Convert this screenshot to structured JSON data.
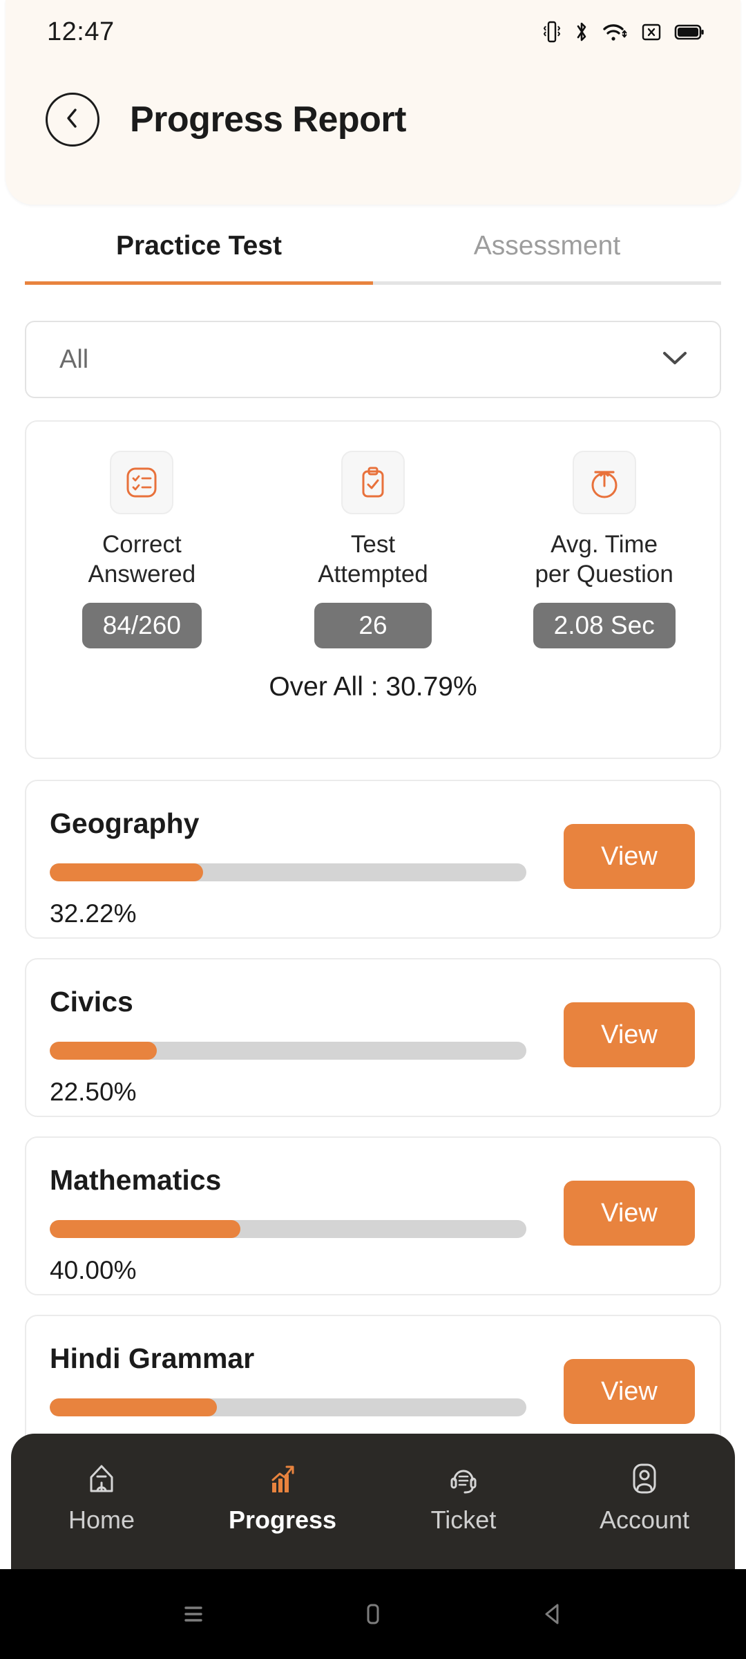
{
  "status_bar": {
    "time": "12:47",
    "icons": [
      "vibrate-icon",
      "bluetooth-icon",
      "wifi-icon",
      "sim-off-icon",
      "battery-full-icon"
    ]
  },
  "appbar": {
    "back_icon": "chevron-left-icon",
    "title": "Progress Report"
  },
  "tabs": [
    {
      "label": "Practice Test",
      "active": true
    },
    {
      "label": "Assessment",
      "active": false
    }
  ],
  "filter": {
    "value": "All",
    "icon": "chevron-down-icon"
  },
  "stats": {
    "items": [
      {
        "icon": "checklist-icon",
        "label": "Correct\nAnswered",
        "label_line1": "Correct",
        "label_line2": "Answered",
        "value": "84/260"
      },
      {
        "icon": "clipboard-check-icon",
        "label": "Test\nAttempted",
        "label_line1": "Test",
        "label_line2": "Attempted",
        "value": "26"
      },
      {
        "icon": "stopwatch-icon",
        "label": "Avg. Time\nper Question",
        "label_line1": "Avg. Time",
        "label_line2": "per Question",
        "value": "2.08 Sec"
      }
    ],
    "overall": "Over All : 30.79%"
  },
  "subjects": [
    {
      "name": "Geography",
      "percent_label": "32.22%",
      "percent": 32.22,
      "button": "View"
    },
    {
      "name": "Civics",
      "percent_label": "22.50%",
      "percent": 22.5,
      "button": "View"
    },
    {
      "name": "Mathematics",
      "percent_label": "40.00%",
      "percent": 40.0,
      "button": "View"
    },
    {
      "name": "Hindi Grammar",
      "percent_label": "",
      "percent": 35.0,
      "button": "View"
    }
  ],
  "bottom_nav": [
    {
      "label": "Home",
      "icon": "home-icon",
      "active": false
    },
    {
      "label": "Progress",
      "icon": "bar-chart-icon",
      "active": true
    },
    {
      "label": "Ticket",
      "icon": "headset-icon",
      "active": false
    },
    {
      "label": "Account",
      "icon": "person-icon",
      "active": false
    }
  ],
  "system_bar": [
    {
      "icon": "recents-icon"
    },
    {
      "icon": "home-square-icon"
    },
    {
      "icon": "back-triangle-icon"
    }
  ],
  "colors": {
    "accent": "#E8833E",
    "header_bg": "#FDF8F2",
    "nav_bg": "#2B2926",
    "pill_bg": "#757575",
    "track": "#D4D4D4"
  }
}
